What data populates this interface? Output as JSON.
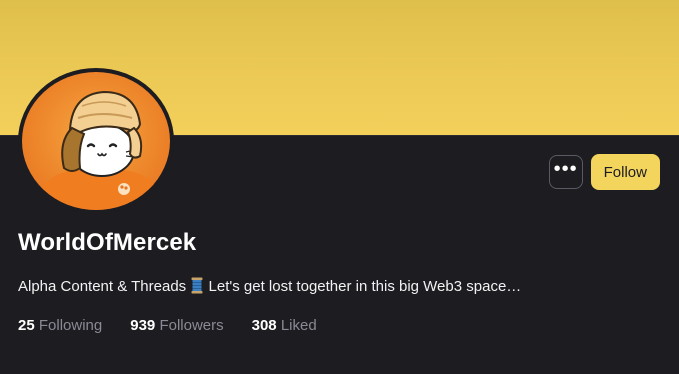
{
  "profile": {
    "display_name": "WorldOfMercek",
    "bio_text": "Alpha Content & Threads",
    "bio_emoji": "thread-spool-emoji",
    "bio_text_after": "Let's get lost together in this big Web3 space…"
  },
  "actions": {
    "more_label": "•••",
    "follow_label": "Follow"
  },
  "stats": {
    "following": {
      "count": "25",
      "label": "Following"
    },
    "followers": {
      "count": "939",
      "label": "Followers"
    },
    "liked": {
      "count": "308",
      "label": "Liked"
    }
  },
  "colors": {
    "banner": "#ecc955",
    "background": "#1c1c21",
    "follow_button": "#f3d55d",
    "muted_text": "#8a8a95"
  },
  "icons": {
    "avatar": "cat-in-ushanka-avatar",
    "more": "ellipsis-icon"
  }
}
